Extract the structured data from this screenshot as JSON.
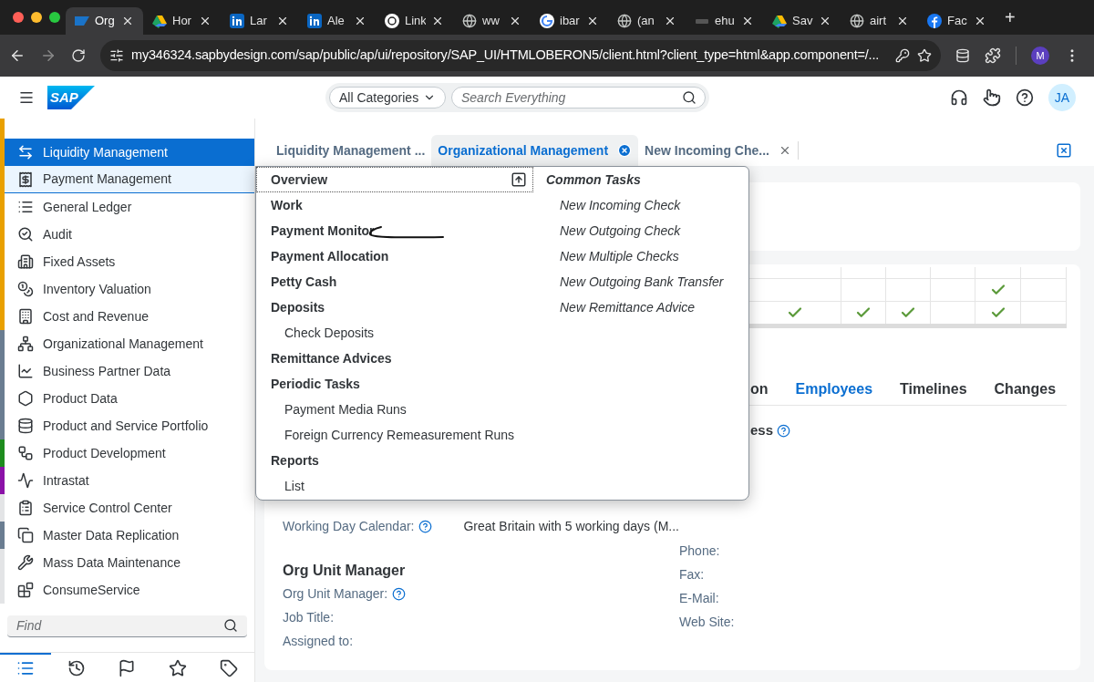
{
  "browser": {
    "tabs": [
      {
        "title": "Org",
        "selected": true
      },
      {
        "title": "Hor",
        "selected": false
      },
      {
        "title": "Lar",
        "selected": false
      },
      {
        "title": "Ale",
        "selected": false
      },
      {
        "title": "Link",
        "selected": false
      },
      {
        "title": "ww",
        "selected": false
      },
      {
        "title": "ibar",
        "selected": false
      },
      {
        "title": "(an",
        "selected": false
      },
      {
        "title": "ehu",
        "selected": false
      },
      {
        "title": "Sav",
        "selected": false
      },
      {
        "title": "airt",
        "selected": false
      },
      {
        "title": "Fac",
        "selected": false
      }
    ],
    "new_tab": "+",
    "address": "my346324.sapbydesign.com/sap/public/ap/ui/repository/SAP_UI/HTMLOBERON5/client.html?client_type=html&app.component=/...",
    "profile": "M"
  },
  "header": {
    "logo": "SAP",
    "category": "All Categories",
    "search_placeholder": "Search Everything",
    "avatar": "JA"
  },
  "sidebar": {
    "items": [
      {
        "label": "Liquidity Management",
        "color": "#e9a000",
        "selected": true,
        "hovered": false
      },
      {
        "label": "Payment Management",
        "color": "#e9a000",
        "selected": false,
        "hovered": true
      },
      {
        "label": "General Ledger",
        "color": "#e9a000",
        "selected": false,
        "hovered": false
      },
      {
        "label": "Audit",
        "color": "#e9a000",
        "selected": false,
        "hovered": false
      },
      {
        "label": "Fixed Assets",
        "color": "#e9a000",
        "selected": false,
        "hovered": false
      },
      {
        "label": "Inventory Valuation",
        "color": "#e9a000",
        "selected": false,
        "hovered": false
      },
      {
        "label": "Cost and Revenue",
        "color": "#e9a000",
        "selected": false,
        "hovered": false
      },
      {
        "label": "Organizational Management",
        "color": "#6a7d91",
        "selected": false,
        "hovered": false
      },
      {
        "label": "Business Partner Data",
        "color": "#6a7d91",
        "selected": false,
        "hovered": false
      },
      {
        "label": "Product Data",
        "color": "#6a7d91",
        "selected": false,
        "hovered": false
      },
      {
        "label": "Product and Service Portfolio",
        "color": "#6a7d91",
        "selected": false,
        "hovered": false
      },
      {
        "label": "Product Development",
        "color": "#1e8c1e",
        "selected": false,
        "hovered": false
      },
      {
        "label": "Intrastat",
        "color": "#8b12a8",
        "selected": false,
        "hovered": false
      },
      {
        "label": "Service Control Center",
        "color": "#e3e4e6",
        "selected": false,
        "hovered": false
      },
      {
        "label": "Master Data Replication",
        "color": "#6a7d91",
        "selected": false,
        "hovered": false
      },
      {
        "label": "Mass Data Maintenance",
        "color": "#e3e4e6",
        "selected": false,
        "hovered": false
      },
      {
        "label": "ConsumeService",
        "color": "#e3e4e6",
        "selected": false,
        "hovered": false
      }
    ],
    "find_placeholder": "Find",
    "bottom_tabs": [
      {
        "selected": true
      },
      {
        "selected": false
      },
      {
        "selected": false
      },
      {
        "selected": false
      },
      {
        "selected": false
      }
    ]
  },
  "work_tabs": [
    {
      "label": "Liquidity Management ...",
      "selected": false,
      "closable": false
    },
    {
      "label": "Organizational Management",
      "selected": true,
      "closable": true
    },
    {
      "label": "New Incoming Che...",
      "selected": false,
      "closable": true
    }
  ],
  "table": {
    "rows": [
      {
        "cells": [
          {
            "checked": false
          },
          {
            "checked": false
          },
          {
            "checked": false
          },
          {
            "checked": false
          },
          {
            "checked": true
          },
          {
            "checked": false
          }
        ]
      },
      {
        "cells": [
          {
            "checked": true
          },
          {
            "checked": true
          },
          {
            "checked": true
          },
          {
            "checked": false
          },
          {
            "checked": true
          },
          {
            "checked": false
          }
        ]
      }
    ]
  },
  "section_tabs": [
    {
      "label": "on",
      "selected": false
    },
    {
      "label": "Employees",
      "selected": true
    },
    {
      "label": "Timelines",
      "selected": false
    },
    {
      "label": "Changes",
      "selected": false
    }
  ],
  "section_heading": "ess",
  "form": {
    "left": [
      {
        "label": "Working Day Calendar:",
        "help": true,
        "value": "Great Britain with 5 working days (M..."
      }
    ],
    "manager_heading": "Org Unit Manager",
    "manager": [
      {
        "label": "Org Unit Manager:",
        "help": true
      },
      {
        "label": "Job Title:",
        "help": false
      },
      {
        "label": "Assigned to:",
        "help": false
      }
    ],
    "contact": [
      "Phone:",
      "Fax:",
      "E-Mail:",
      "Web Site:"
    ]
  },
  "menu": {
    "sections": [
      {
        "label": "Overview",
        "focused": true
      },
      {
        "label": "Work",
        "focused": false
      },
      {
        "label": "Payment Monitor",
        "focused": false
      },
      {
        "label": "Payment Allocation",
        "focused": false
      },
      {
        "label": "Petty Cash",
        "focused": false
      },
      {
        "label": "Deposits",
        "focused": false,
        "children": [
          {
            "label": "Check Deposits"
          }
        ]
      },
      {
        "label": "Remittance Advices",
        "focused": false
      },
      {
        "label": "Periodic Tasks",
        "focused": false,
        "children": [
          {
            "label": "Payment Media Runs"
          },
          {
            "label": "Foreign Currency Remeasurement Runs"
          }
        ]
      },
      {
        "label": "Reports",
        "focused": false,
        "children": [
          {
            "label": "List"
          }
        ]
      }
    ],
    "common_tasks": {
      "title": "Common Tasks",
      "items": [
        "New Incoming Check",
        "New Outgoing Check",
        "New Multiple Checks",
        "New Outgoing Bank Transfer",
        "New Remittance Advice"
      ]
    }
  }
}
